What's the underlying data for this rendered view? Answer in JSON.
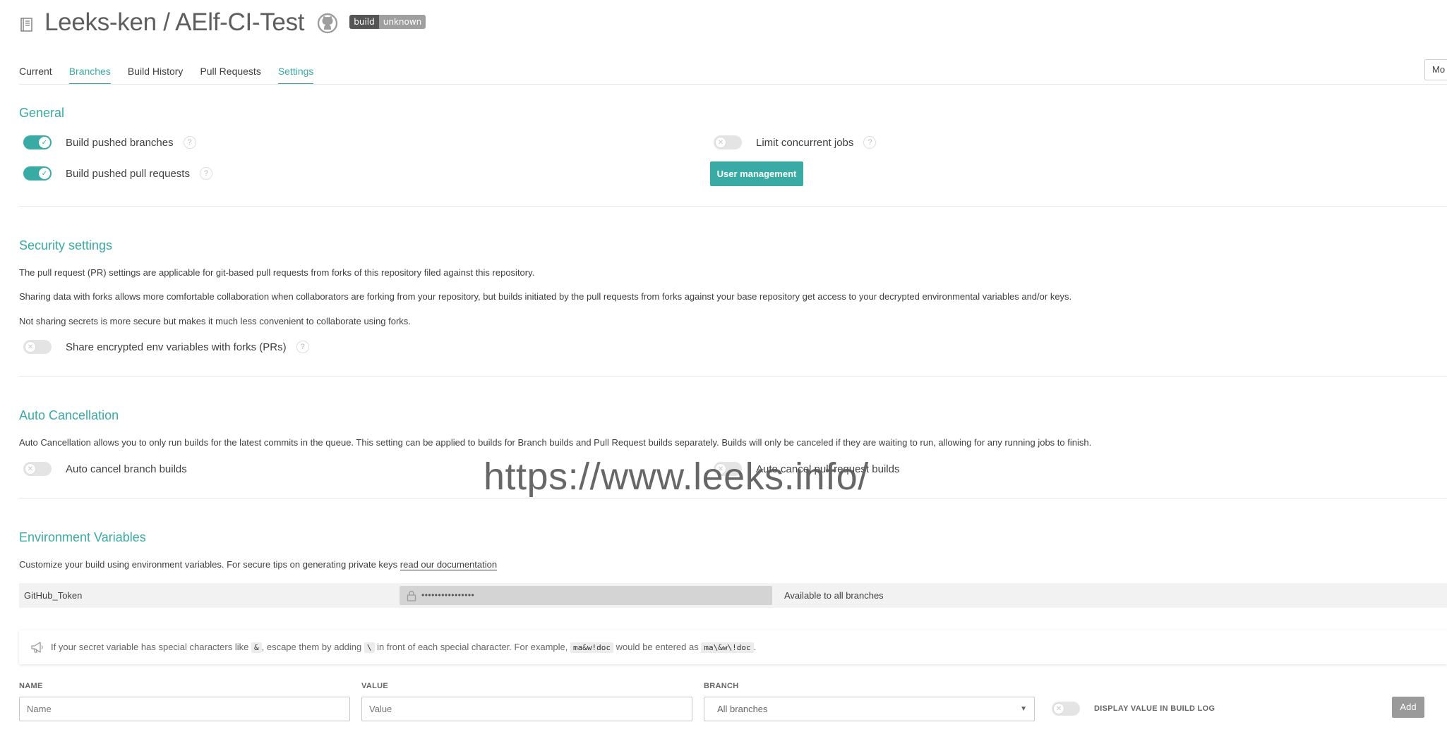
{
  "header": {
    "repo_title": "Leeks-ken / AElf-CI-Test",
    "badge_left": "build",
    "badge_right": "unknown"
  },
  "tabs": [
    {
      "label": "Current"
    },
    {
      "label": "Branches"
    },
    {
      "label": "Build History"
    },
    {
      "label": "Pull Requests"
    },
    {
      "label": "Settings"
    }
  ],
  "more_button": "Mo",
  "general": {
    "title": "General",
    "build_pushed_branches": {
      "label": "Build pushed branches",
      "on": true
    },
    "build_pushed_prs": {
      "label": "Build pushed pull requests",
      "on": true
    },
    "limit_concurrent": {
      "label": "Limit concurrent jobs",
      "on": false
    },
    "user_management_button": "User management"
  },
  "security": {
    "title": "Security settings",
    "para1": "The pull request (PR) settings are applicable for git-based pull requests from forks of this repository filed against this repository.",
    "para2": "Sharing data with forks allows more comfortable collaboration when collaborators are forking from your repository, but builds initiated by the pull requests from forks against your base repository get access to your decrypted environmental variables and/or keys.",
    "para3": "Not sharing secrets is more secure but makes it much less convenient to collaborate using forks.",
    "share_toggle": {
      "label": "Share encrypted env variables with forks (PRs)",
      "on": false
    }
  },
  "auto_cancel": {
    "title": "Auto Cancellation",
    "description": "Auto Cancellation allows you to only run builds for the latest commits in the queue. This setting can be applied to builds for Branch builds and Pull Request builds separately. Builds will only be canceled if they are waiting to run, allowing for any running jobs to finish.",
    "branch_toggle": {
      "label": "Auto cancel branch builds",
      "on": false
    },
    "pr_toggle": {
      "label": "Auto cancel pull request builds",
      "on": false
    }
  },
  "watermark": "https://www.leeks.info/",
  "env_vars": {
    "title": "Environment Variables",
    "description": "Customize your build using environment variables. For secure tips on generating private keys",
    "doc_link": "read our documentation",
    "rows": [
      {
        "name": "GitHub_Token",
        "value_masked": "••••••••••••••••",
        "branch": "Available to all branches"
      }
    ],
    "notice": {
      "t1": "If your secret variable has special characters like",
      "c1": "&",
      "t2": ", escape them by adding",
      "c2": "\\",
      "t3": "in front of each special character. For example,",
      "c3": "ma&w!doc",
      "t4": "would be entered as",
      "c4": "ma\\&w\\!doc",
      "t5": "."
    },
    "form": {
      "name_label": "NAME",
      "name_placeholder": "Name",
      "value_label": "VALUE",
      "value_placeholder": "Value",
      "branch_label": "BRANCH",
      "branch_selected": "All branches",
      "display_label": "DISPLAY VALUE IN BUILD LOG",
      "display_on": false,
      "add_button": "Add"
    }
  }
}
